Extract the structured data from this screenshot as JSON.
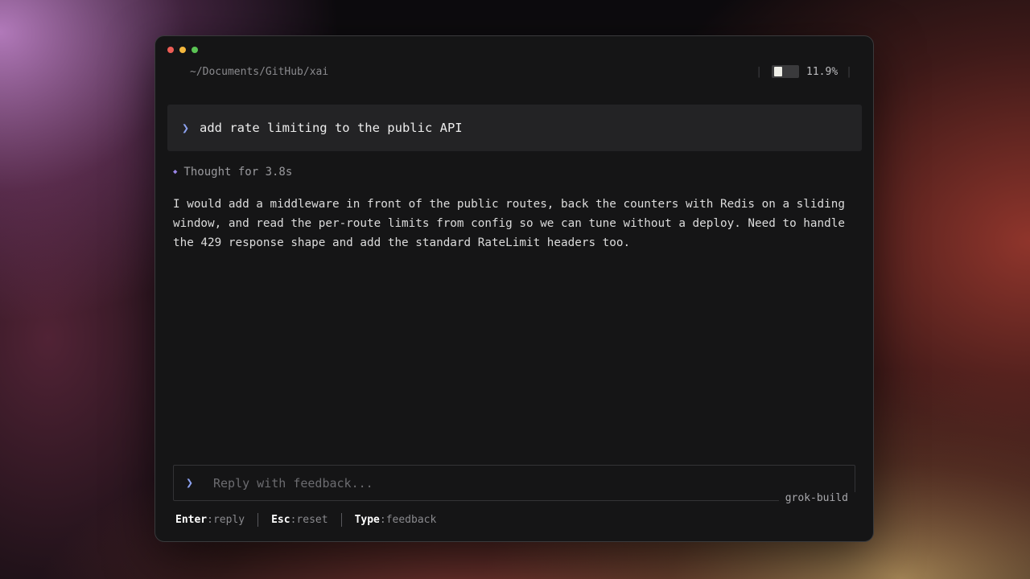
{
  "window": {
    "path": "~/Documents/GitHub/xai",
    "usage": {
      "percent_label": "11.9%",
      "fraction": 0.119
    }
  },
  "conversation": {
    "prompt_symbol": "❯",
    "user_prompt": "add rate limiting to the public API",
    "thought_label": "Thought for 3.8s",
    "response": "I would add a middleware in front of the public routes, back the counters with Redis on a sliding window, and read the per-route limits from config so we can tune without a deploy. Need to handle the 429 response shape and add the standard RateLimit headers too."
  },
  "reply": {
    "placeholder": "Reply with feedback...",
    "value": "",
    "model": "grok-build"
  },
  "shortcuts": [
    {
      "key": "Enter",
      "action": ":reply"
    },
    {
      "key": "Esc",
      "action": ":reset"
    },
    {
      "key": "Type",
      "action": ":feedback"
    }
  ],
  "colors": {
    "accent": "#8da2f0",
    "thought_diamond": "#9b86e8",
    "window_bg": "#151516",
    "prompt_bg": "#232325"
  },
  "icons": {
    "prompt": "chevron-right-icon",
    "thought": "diamond-icon"
  }
}
